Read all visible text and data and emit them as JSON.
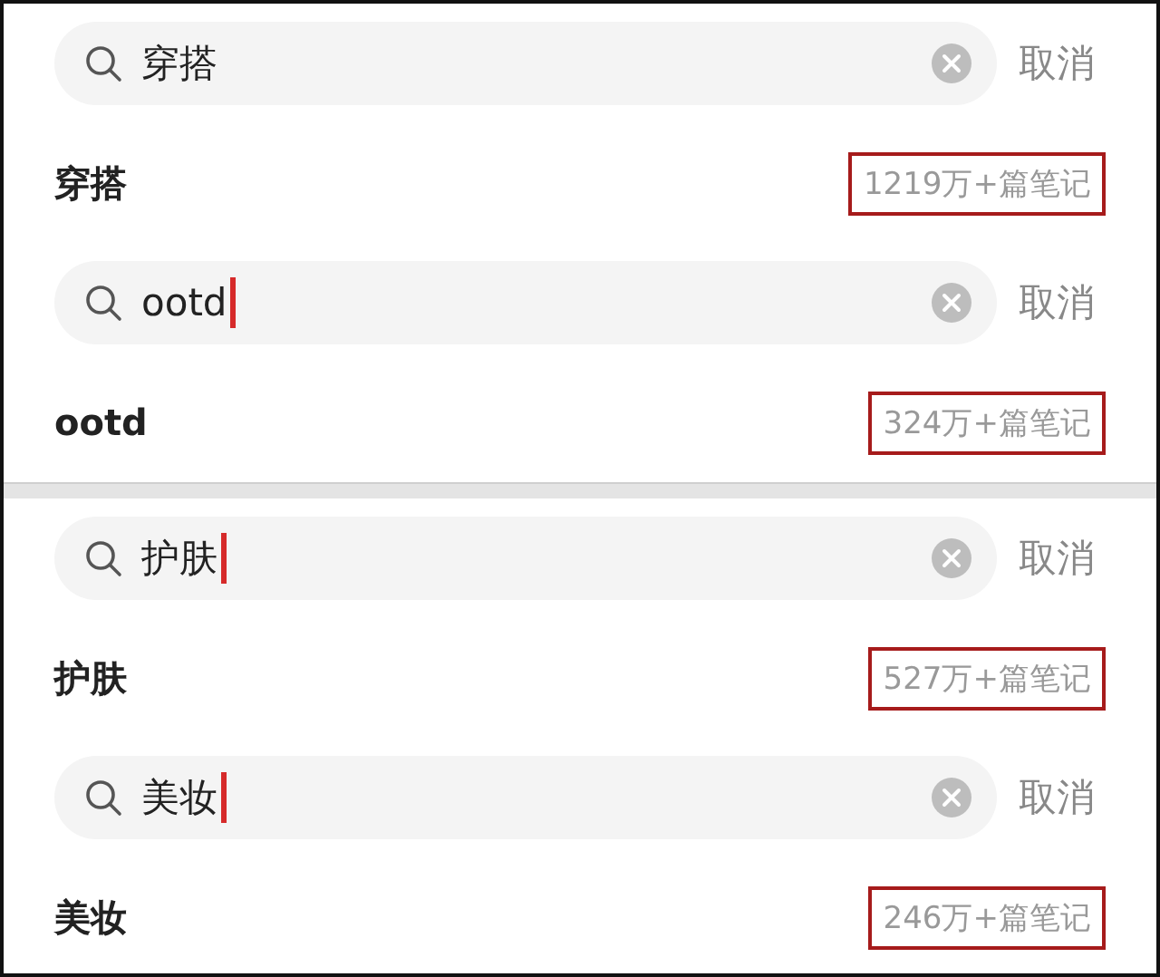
{
  "panels": [
    {
      "blocks": [
        {
          "query": "穿搭",
          "cursor": false,
          "cancel": "取消",
          "suggestion": "穿搭",
          "count": "1219万+篇笔记",
          "highlighted": true
        },
        {
          "query": "ootd",
          "cursor": true,
          "cancel": "取消",
          "suggestion": "ootd",
          "count": "324万+篇笔记",
          "highlighted": true
        }
      ]
    },
    {
      "blocks": [
        {
          "query": "护肤",
          "cursor": true,
          "cancel": "取消",
          "suggestion": "护肤",
          "count": "527万+篇笔记",
          "highlighted": true
        },
        {
          "query": "美妆",
          "cursor": true,
          "cancel": "取消",
          "suggestion": "美妆",
          "count": "246万+篇笔记",
          "highlighted": true
        }
      ]
    }
  ]
}
